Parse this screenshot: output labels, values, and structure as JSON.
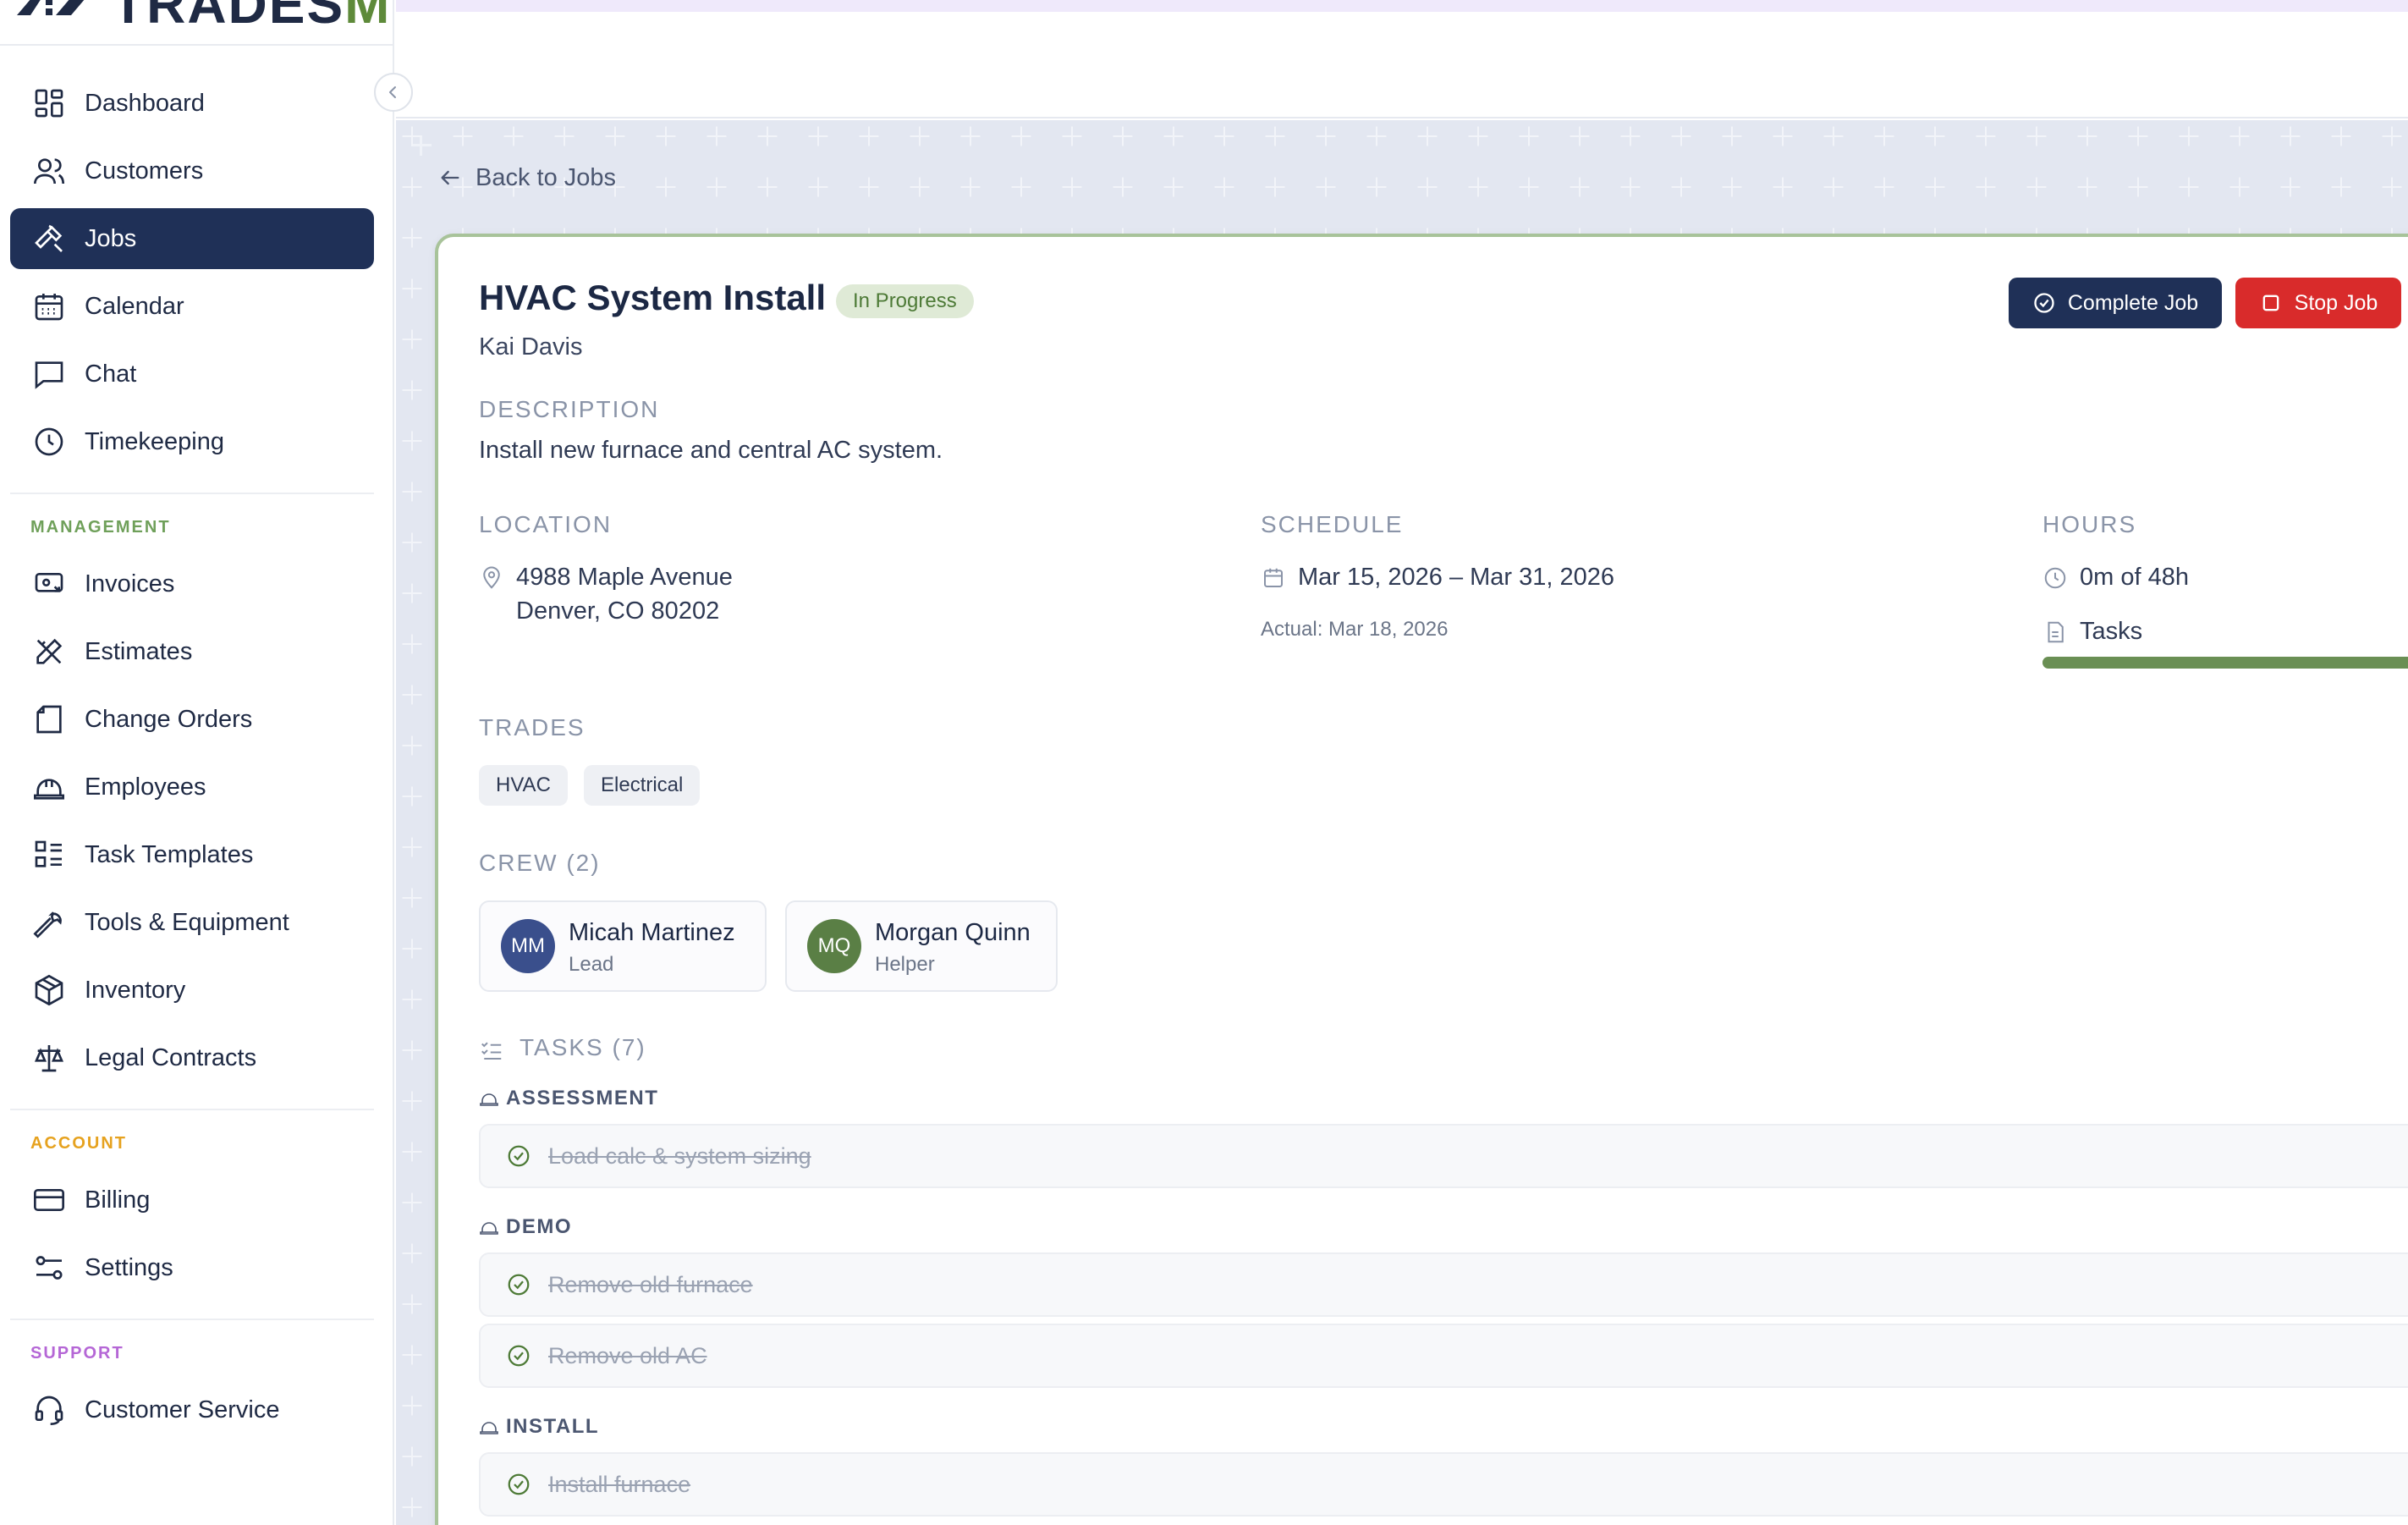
{
  "app": {
    "logo_prefix": "TRADES",
    "logo_suffix": "MIN"
  },
  "sidebar": {
    "main_items": [
      {
        "label": "Dashboard",
        "icon": "dashboard-icon"
      },
      {
        "label": "Customers",
        "icon": "users-icon"
      },
      {
        "label": "Jobs",
        "icon": "hammer-icon",
        "active": true
      },
      {
        "label": "Calendar",
        "icon": "calendar-icon"
      },
      {
        "label": "Chat",
        "icon": "chat-icon"
      },
      {
        "label": "Timekeeping",
        "icon": "clock-icon"
      }
    ],
    "management_label": "MANAGEMENT",
    "management_items": [
      {
        "label": "Invoices",
        "icon": "invoice-icon"
      },
      {
        "label": "Estimates",
        "icon": "ruler-pencil-icon"
      },
      {
        "label": "Change Orders",
        "icon": "document-icon"
      },
      {
        "label": "Employees",
        "icon": "hardhat-icon"
      },
      {
        "label": "Task Templates",
        "icon": "list-icon"
      },
      {
        "label": "Tools & Equipment",
        "icon": "wrench-icon"
      },
      {
        "label": "Inventory",
        "icon": "package-icon"
      },
      {
        "label": "Legal Contracts",
        "icon": "scale-icon"
      }
    ],
    "account_label": "ACCOUNT",
    "account_items": [
      {
        "label": "Billing",
        "icon": "credit-card-icon"
      },
      {
        "label": "Settings",
        "icon": "settings-sliders-icon"
      }
    ],
    "support_label": "SUPPORT",
    "support_items": [
      {
        "label": "Customer Service",
        "icon": "headset-icon"
      }
    ]
  },
  "colors": {
    "primary": "#1f3057",
    "danger": "#d92b2b",
    "success": "#6a8f54",
    "management": "#6fa05a",
    "account": "#e6a21f",
    "support": "#b567d6"
  },
  "main": {
    "back_label": "Back to Jobs",
    "job": {
      "title": "HVAC System Install",
      "status": "In Progress",
      "customer": "Kai Davis",
      "complete_label": "Complete Job",
      "stop_label": "Stop Job",
      "description_label": "DESCRIPTION",
      "description": "Install new furnace and central AC system.",
      "location_label": "LOCATION",
      "address_line1": "4988 Maple Avenue",
      "address_line2": "Denver, CO 80202",
      "schedule_label": "SCHEDULE",
      "schedule_range": "Mar 15, 2026 – Mar 31, 2026",
      "actual": "Actual: Mar 18, 2026",
      "hours_label": "HOURS",
      "hours": "0m of 48h",
      "tasks_progress_label": "Tasks",
      "tasks_progress": 1.0,
      "trades_label": "TRADES",
      "trades": [
        "HVAC",
        "Electrical"
      ],
      "crew_label": "CREW (2)",
      "crew": [
        {
          "initials": "MM",
          "name": "Micah Martinez",
          "role": "Lead",
          "color": "#3a4f8c"
        },
        {
          "initials": "MQ",
          "name": "Morgan Quinn",
          "role": "Helper",
          "color": "#5a7f45"
        }
      ],
      "tasks_label": "TASKS (7)",
      "task_groups": [
        {
          "name": "ASSESSMENT",
          "tasks": [
            "Load calc & system sizing"
          ]
        },
        {
          "name": "DEMO",
          "tasks": [
            "Remove old furnace",
            "Remove old AC"
          ]
        },
        {
          "name": "INSTALL",
          "tasks": [
            "Install furnace"
          ]
        }
      ]
    }
  }
}
